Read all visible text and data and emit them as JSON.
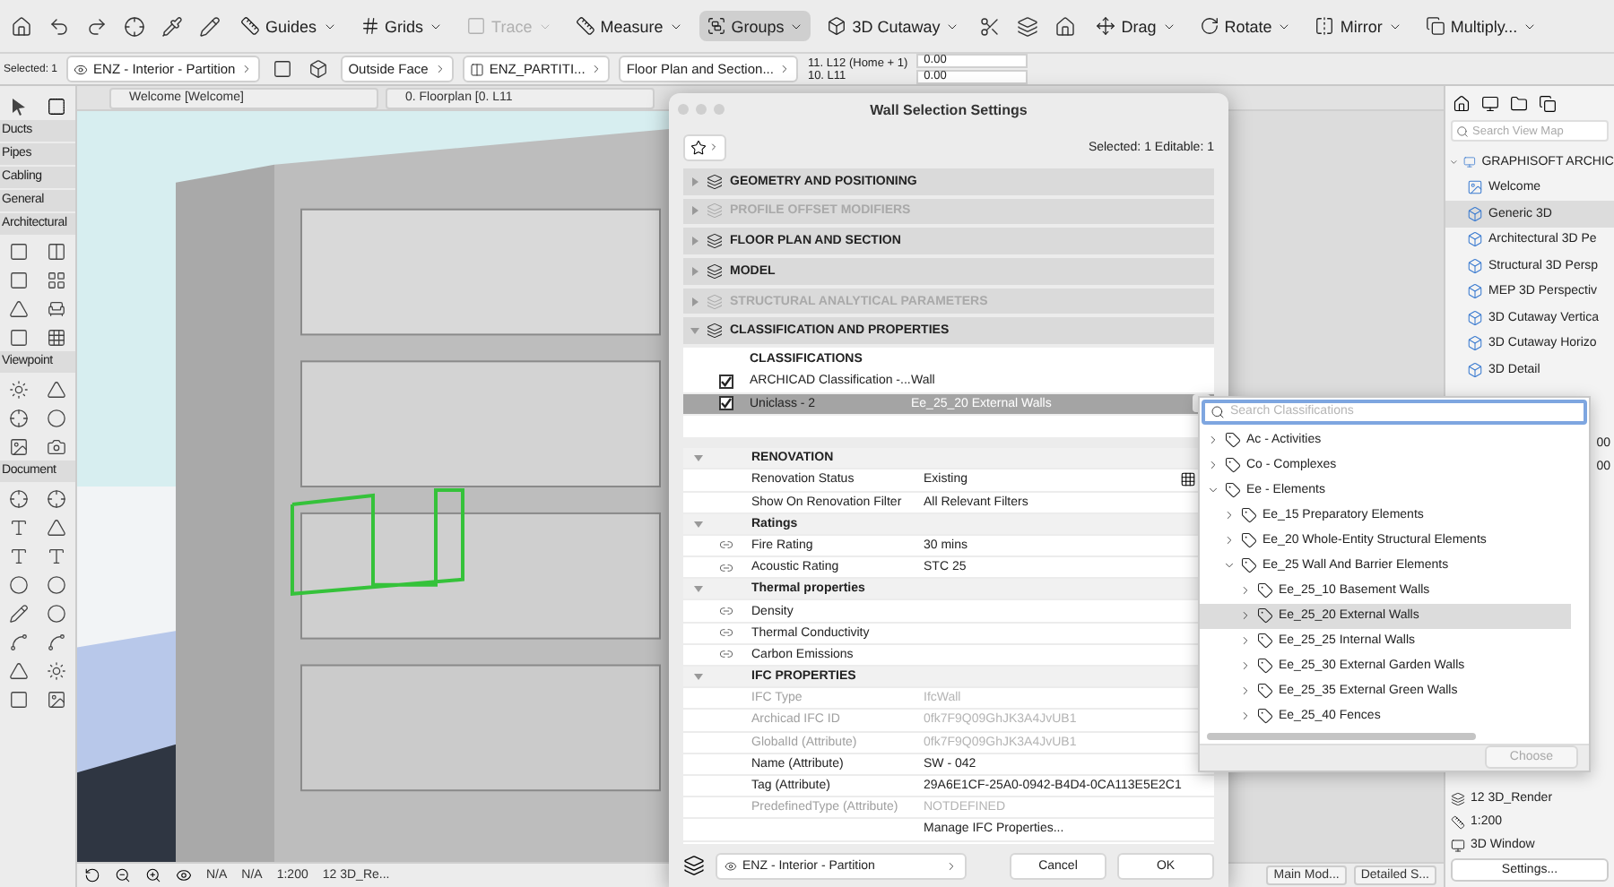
{
  "toolbar": {
    "tools": [
      {
        "label": "Guides",
        "selected": false,
        "disabled": false
      },
      {
        "label": "Grids",
        "selected": false,
        "disabled": false
      },
      {
        "label": "Trace",
        "selected": false,
        "disabled": true
      },
      {
        "label": "Measure",
        "selected": false,
        "disabled": false
      },
      {
        "label": "Groups",
        "selected": true,
        "disabled": false
      },
      {
        "label": "3D Cutaway",
        "selected": false,
        "disabled": false
      }
    ],
    "edit_tools": [
      {
        "label": "Drag"
      },
      {
        "label": "Rotate"
      },
      {
        "label": "Mirror"
      },
      {
        "label": "Multiply..."
      }
    ]
  },
  "info_bar": {
    "selection_label": "Selected: 1",
    "layer": "ENZ - Interior - Partition",
    "reference_line": "Outside Face",
    "composite": "ENZ_PARTITI...",
    "display": "Floor Plan and Section...",
    "top_story": "11. L12 (Home + 1)",
    "bottom_story": "10. L11",
    "offsets": [
      "0.00",
      "0.00"
    ]
  },
  "palette": {
    "sections": [
      {
        "label": "Ducts"
      },
      {
        "label": "Pipes"
      },
      {
        "label": "Cabling"
      },
      {
        "label": "General"
      },
      {
        "label": "Architectural"
      },
      {
        "label": "Viewpoint"
      },
      {
        "label": "Document"
      }
    ]
  },
  "view_tabs": [
    {
      "label": "Welcome [Welcome]"
    },
    {
      "label": "0. Floorplan [0. L11"
    }
  ],
  "view_status": {
    "values": [
      "N/A",
      "N/A",
      "1:200",
      "12 3D_Re..."
    ],
    "right": [
      "Main Mod...",
      "Detailed S..."
    ]
  },
  "navigator": {
    "search_placeholder": "Search View Map",
    "root": {
      "label": "GRAPHISOFT ARCHIC",
      "expanded": true,
      "children": [
        {
          "label": "Welcome",
          "selected": false
        },
        {
          "label": "Generic 3D",
          "selected": true
        },
        {
          "label": "Architectural 3D Pe",
          "selected": false
        },
        {
          "label": "Structural 3D Persp",
          "selected": false
        },
        {
          "label": "MEP 3D Perspectiv",
          "selected": false
        },
        {
          "label": "3D Cutaway Vertica",
          "selected": false
        },
        {
          "label": "3D Cutaway Horizo",
          "selected": false
        },
        {
          "label": "3D Detail",
          "selected": false
        }
      ]
    },
    "partial_values": [
      "00",
      "00"
    ],
    "view_info": [
      "12 3D_Render",
      "1:200",
      "3D Window"
    ],
    "settings_button": "Settings..."
  },
  "dialog": {
    "title": "Wall Selection Settings",
    "selection_info": "Selected: 1 Editable: 1",
    "panels": [
      {
        "label": "GEOMETRY AND POSITIONING",
        "enabled": true,
        "expanded": false
      },
      {
        "label": "PROFILE OFFSET MODIFIERS",
        "enabled": false,
        "expanded": false
      },
      {
        "label": "FLOOR PLAN AND SECTION",
        "enabled": true,
        "expanded": false
      },
      {
        "label": "MODEL",
        "enabled": true,
        "expanded": false
      },
      {
        "label": "STRUCTURAL ANALYTICAL PARAMETERS",
        "enabled": false,
        "expanded": false
      },
      {
        "label": "CLASSIFICATION AND PROPERTIES",
        "enabled": true,
        "expanded": true
      }
    ],
    "classifications": {
      "heading": "CLASSIFICATIONS",
      "rows": [
        {
          "system": "ARCHICAD Classification -...",
          "value": "Wall",
          "checked": true,
          "selected": false
        },
        {
          "system": "Uniclass - 2",
          "value": "Ee_25_20 External Walls",
          "checked": true,
          "selected": true
        }
      ]
    },
    "property_groups": [
      {
        "label": "RENOVATION",
        "expanded": true,
        "rows": [
          {
            "name": "Renovation Status",
            "value": "Existing",
            "kind": "choice",
            "linked": false,
            "disabled": false
          },
          {
            "name": "Show On Renovation Filter",
            "value": "All Relevant Filters",
            "kind": "text",
            "linked": false,
            "disabled": false
          }
        ]
      },
      {
        "label": "Ratings",
        "expanded": true,
        "rows": [
          {
            "name": "Fire Rating",
            "value": "30 mins",
            "kind": "text",
            "linked": true,
            "disabled": false
          },
          {
            "name": "Acoustic Rating",
            "value": "STC 25",
            "kind": "text",
            "linked": true,
            "disabled": false
          }
        ]
      },
      {
        "label": "Thermal properties",
        "expanded": true,
        "rows": [
          {
            "name": "Density",
            "kind": "text",
            "linked": true,
            "disabled": false
          },
          {
            "name": "Thermal Conductivity",
            "kind": "text",
            "linked": true,
            "disabled": false
          },
          {
            "name": "Carbon Emissions",
            "kind": "text",
            "linked": true,
            "disabled": false
          }
        ]
      },
      {
        "label": "IFC PROPERTIES",
        "expanded": true,
        "rows": [
          {
            "name": "IFC Type",
            "value": "IfcWall",
            "kind": "text",
            "linked": false,
            "disabled": true
          },
          {
            "name": "Archicad IFC ID",
            "value": "0fk7F9Q09GhJK3A4JvUB1",
            "kind": "text",
            "linked": false,
            "disabled": true
          },
          {
            "name": "GlobalId (Attribute)",
            "value": "0fk7F9Q09GhJK3A4JvUB1",
            "kind": "text",
            "linked": false,
            "disabled": true
          },
          {
            "name": "Name (Attribute)",
            "value": "SW - 042",
            "kind": "text",
            "linked": false,
            "disabled": false
          },
          {
            "name": "Tag (Attribute)",
            "value": "29A6E1CF-25A0-0942-B4D4-0CA113E5E2C1",
            "kind": "text",
            "linked": false,
            "disabled": false
          },
          {
            "name": "PredefinedType (Attribute)",
            "value": "NOTDEFINED",
            "kind": "text",
            "linked": false,
            "disabled": true
          }
        ]
      }
    ],
    "manage_button": "Manage IFC Properties...",
    "layer": "ENZ - Interior - Partition",
    "buttons": [
      {
        "label": "Cancel"
      },
      {
        "label": "OK"
      }
    ]
  },
  "classification_picker": {
    "placeholder": "Search Classifications",
    "choose_button": {
      "label": "Choose",
      "disabled": true
    },
    "items": [
      {
        "label": "Ac - Activities",
        "expanded": false,
        "selected": false
      },
      {
        "label": "Co - Complexes",
        "expanded": false,
        "selected": false
      },
      {
        "label": "Ee - Elements",
        "expanded": true,
        "selected": false,
        "children": [
          {
            "label": "Ee_15 Preparatory Elements",
            "expanded": false,
            "selected": false
          },
          {
            "label": "Ee_20 Whole-Entity Structural Elements",
            "expanded": false,
            "selected": false
          },
          {
            "label": "Ee_25 Wall And Barrier Elements",
            "expanded": true,
            "selected": false,
            "children": [
              {
                "label": "Ee_25_10 Basement Walls",
                "expanded": false,
                "selected": false
              },
              {
                "label": "Ee_25_20 External Walls",
                "expanded": false,
                "selected": true
              },
              {
                "label": "Ee_25_25 Internal Walls",
                "expanded": false,
                "selected": false
              },
              {
                "label": "Ee_25_30 External Garden Walls",
                "expanded": false,
                "selected": false
              },
              {
                "label": "Ee_25_35 External Green Walls",
                "expanded": false,
                "selected": false
              },
              {
                "label": "Ee_25_40 Fences",
                "expanded": false,
                "selected": false
              }
            ]
          }
        ]
      }
    ]
  }
}
